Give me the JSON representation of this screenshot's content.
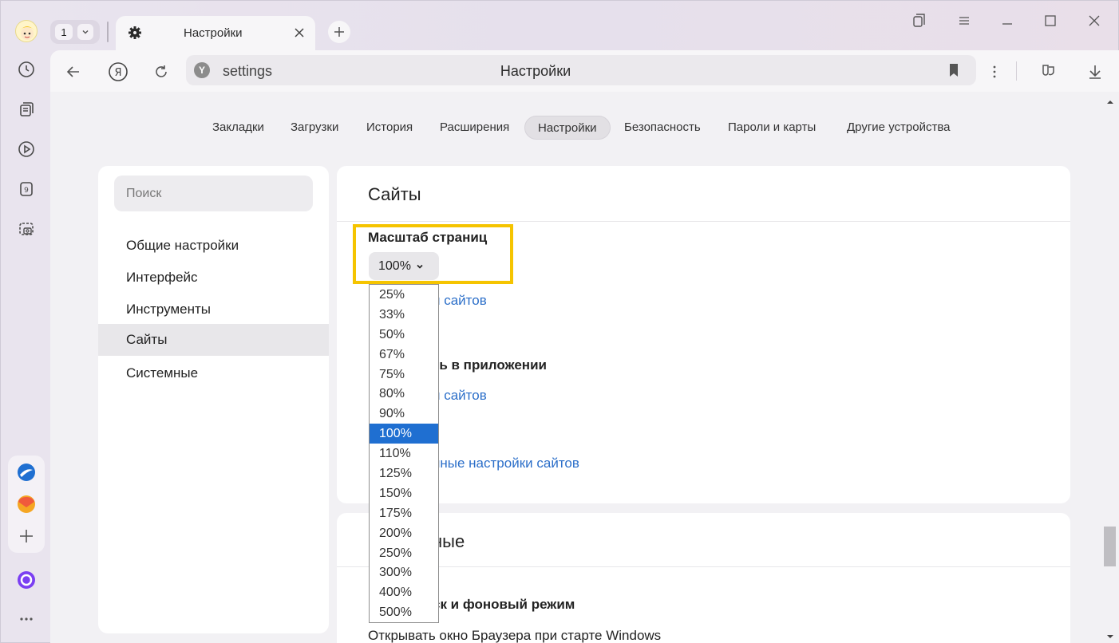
{
  "tabs": {
    "count": "1",
    "active_title": "Настройки"
  },
  "address_bar": {
    "url": "settings",
    "page_title": "Настройки"
  },
  "top_nav": {
    "items": [
      "Закладки",
      "Загрузки",
      "История",
      "Расширения",
      "Настройки",
      "Безопасность",
      "Пароли и карты",
      "Другие устройства"
    ],
    "active": "Настройки"
  },
  "left_menu": {
    "search_placeholder": "Поиск",
    "items": [
      "Общие настройки",
      "Интерфейс",
      "Инструменты",
      "Сайты",
      "Системные"
    ],
    "active": "Сайты"
  },
  "sites_card": {
    "title": "Сайты",
    "zoom_label": "Масштаб страниц",
    "zoom_value": "100%",
    "link1_partial": "и сайтов",
    "label2_partial": "ть в приложении",
    "link2_partial": "и сайтов",
    "link3_partial": "нные настройки сайтов"
  },
  "system_card": {
    "title_partial": "ные",
    "label_partial": "ск и фоновый режим",
    "text_partial": "Открывать окно Браузера при старте Windows"
  },
  "zoom_dropdown": {
    "options": [
      "25%",
      "33%",
      "50%",
      "67%",
      "75%",
      "80%",
      "90%",
      "100%",
      "110%",
      "125%",
      "150%",
      "175%",
      "200%",
      "250%",
      "300%",
      "400%",
      "500%"
    ],
    "selected": "100%"
  },
  "colors": {
    "highlight": "#f5c400",
    "link": "#2c6fc9",
    "selected_option": "#1f6fd1"
  }
}
